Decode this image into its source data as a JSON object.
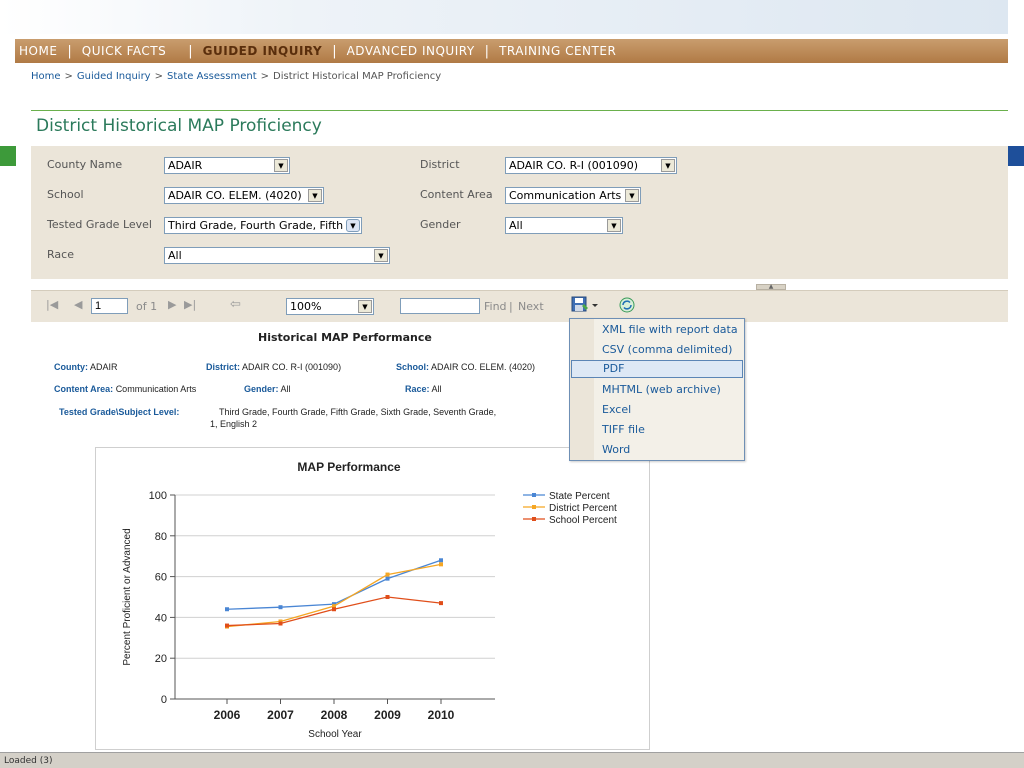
{
  "nav": {
    "items": [
      {
        "label": "HOME",
        "active": false
      },
      {
        "label": "QUICK FACTS",
        "active": false
      },
      {
        "label": "GUIDED INQUIRY",
        "active": true
      },
      {
        "label": "ADVANCED INQUIRY",
        "active": false
      },
      {
        "label": "TRAINING CENTER",
        "active": false
      }
    ]
  },
  "breadcrumb": {
    "home": "Home",
    "guided": "Guided Inquiry",
    "state": "State Assessment",
    "current": "District Historical MAP Proficiency",
    "sep": ">"
  },
  "page": {
    "title": "District Historical MAP Proficiency"
  },
  "params": {
    "county_label": "County Name",
    "county_value": "ADAIR",
    "district_label": "District",
    "district_value": "ADAIR CO. R-I (001090)",
    "school_label": "School",
    "school_value": "ADAIR CO. ELEM. (4020)",
    "content_label": "Content Area",
    "content_value": "Communication Arts",
    "grade_label": "Tested Grade Level",
    "grade_value": "Third Grade, Fourth Grade, Fifth",
    "gender_label": "Gender",
    "gender_value": "All",
    "race_label": "Race",
    "race_value": "All"
  },
  "toolbar": {
    "page_value": "1",
    "of_label": "of 1",
    "zoom_value": "100%",
    "find_value": "",
    "find_label": "Find",
    "sep": "|",
    "next_label": "Next"
  },
  "export_menu": {
    "items": [
      {
        "label": "XML file with report data"
      },
      {
        "label": "CSV (comma delimited)"
      },
      {
        "label": "PDF",
        "hover": true
      },
      {
        "label": "MHTML (web archive)"
      },
      {
        "label": "Excel"
      },
      {
        "label": "TIFF file"
      },
      {
        "label": "Word"
      }
    ]
  },
  "report": {
    "title": "Historical MAP Performance",
    "county_label": "County:",
    "county_value": "ADAIR",
    "district_label": "District:",
    "district_value": "ADAIR CO. R-I (001090)",
    "school_label": "School:",
    "school_value": "ADAIR CO. ELEM. (4020)",
    "content_label": "Content Area:",
    "content_value": "Communication Arts",
    "gender_label": "Gender:",
    "gender_value": "All",
    "race_label": "Race:",
    "race_value": "All",
    "grade_label": "Tested Grade\\Subject Level:",
    "grade_value_line1": "Third Grade,  Fourth Grade,  Fifth Grade,  Sixth Grade,  Seventh Grade,",
    "grade_value_line2": "1,  English 2"
  },
  "chart_data": {
    "type": "line",
    "title": "MAP Performance",
    "xlabel": "School Year",
    "ylabel": "Percent Proficient or Advanced",
    "x": [
      2006,
      2007,
      2008,
      2009,
      2010
    ],
    "ylim": [
      0,
      100
    ],
    "yticks": [
      0,
      20,
      40,
      60,
      80,
      100
    ],
    "grid": true,
    "legend": "top-right",
    "series": [
      {
        "name": "State Percent",
        "color": "#4a86d4",
        "values": [
          44,
          45,
          46.5,
          59,
          68
        ]
      },
      {
        "name": "District Percent",
        "color": "#f5a623",
        "values": [
          35.5,
          38,
          45.5,
          61,
          66
        ]
      },
      {
        "name": "School Percent",
        "color": "#e04e1a",
        "values": [
          36,
          37,
          44,
          50,
          47
        ]
      }
    ]
  },
  "status": {
    "text": "Loaded (3)"
  }
}
